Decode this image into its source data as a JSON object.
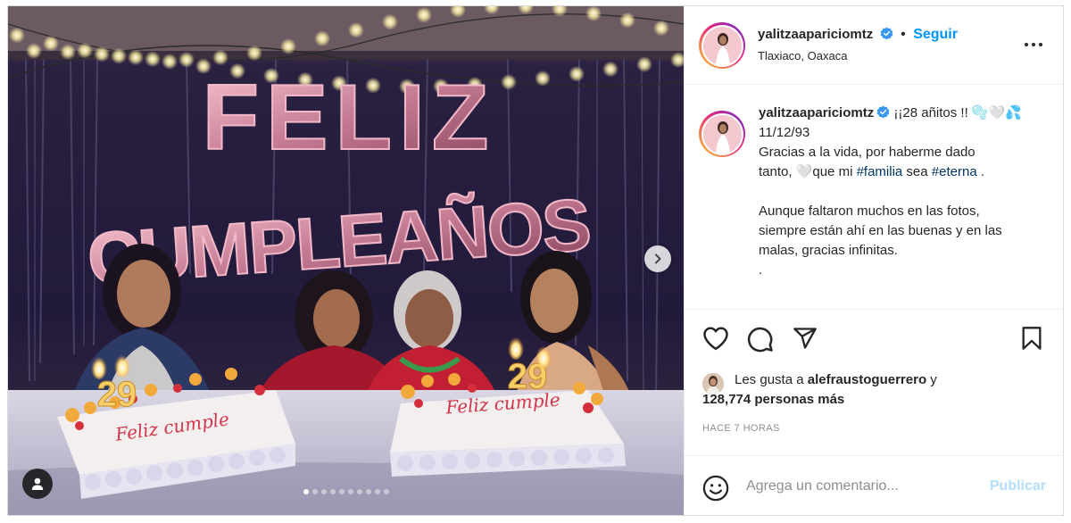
{
  "post": {
    "username": "yalitzaapariciomtz",
    "follow_label": "Seguir",
    "location": "Tlaxiaco, Oaxaca"
  },
  "photo": {
    "balloon_line1": "FELIZ",
    "balloon_line2": "CUMPLEAÑOS",
    "cake_number_left": "29",
    "cake_number_right": "29",
    "cake_writing": "Feliz cumple",
    "carousel_dots": 10,
    "carousel_active_index": 0
  },
  "caption": {
    "username": "yalitzaapariciomtz",
    "headline": "¡¡28 añitos !! 🫧🤍💦",
    "date": "11/12/93",
    "line1": "Gracias a la vida, por haberme dado",
    "line2_a": "tanto, 🤍que mi ",
    "hashtag1": "#familia",
    "line2_b": " sea ",
    "hashtag2": "#eterna",
    "line2_c": " .",
    "para2_line1": "Aunque faltaron muchos en las fotos,",
    "para2_line2": "siempre están ahí en las buenas y en las",
    "para2_line3": "malas, gracias infinitas.",
    "para2_line4": "."
  },
  "likes": {
    "prefix": "Les gusta a ",
    "user": "alefraustoguerrero",
    "connector": " y",
    "count": "128,774 personas más"
  },
  "timestamp": "HACE 7 HORAS",
  "comment": {
    "placeholder": "Agrega un comentario...",
    "publish_label": "Publicar"
  },
  "colors": {
    "link_blue": "#0095f6",
    "publish_disabled": "#b2dffc",
    "hashtag": "#00376b",
    "muted": "#8e8e8e"
  }
}
